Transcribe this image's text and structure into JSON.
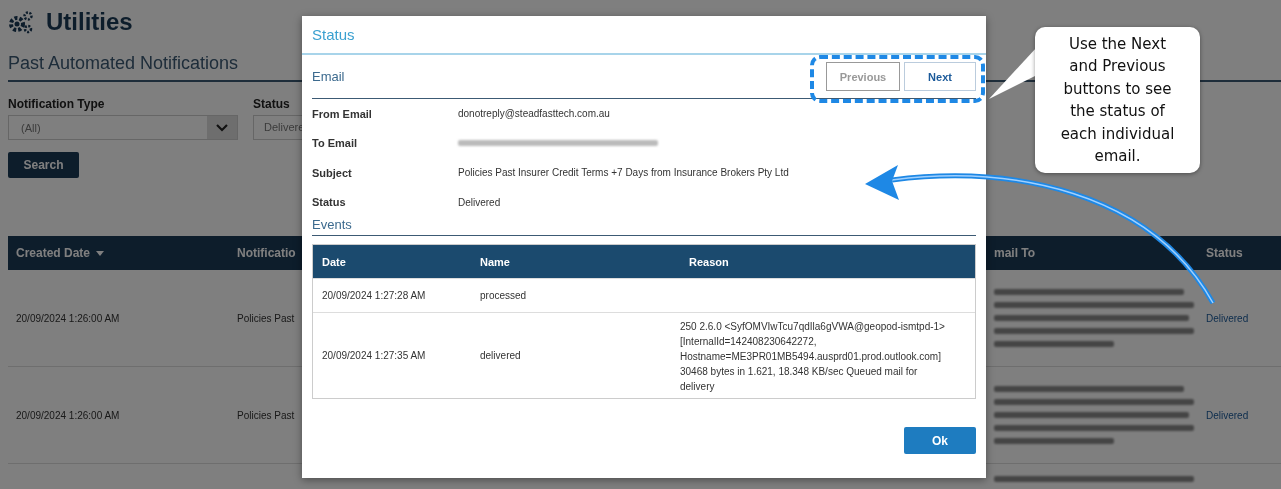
{
  "page": {
    "title": "Utilities",
    "subtitle": "Past Automated Notifications",
    "filters": [
      {
        "label": "Notification Type",
        "value": "(All)",
        "kind": "dropdown"
      },
      {
        "label": "Status",
        "value": "Delivere",
        "kind": "field"
      }
    ],
    "search_button": "Search",
    "table": {
      "columns": [
        {
          "label": "Created Date",
          "sorted": true
        },
        {
          "label": "Notificatio",
          "sorted": false
        },
        {
          "label": "mail To",
          "sorted": false
        },
        {
          "label": "Status",
          "sorted": false
        }
      ],
      "rows": [
        {
          "created_date": "20/09/2024 1:26:00 AM",
          "notification": "Policies Past",
          "status": "Delivered"
        },
        {
          "created_date": "20/09/2024 1:26:00 AM",
          "notification": "Policies Past",
          "status": "Delivered"
        }
      ]
    }
  },
  "dialog": {
    "title": "Status",
    "section": "Email",
    "buttons": [
      {
        "label": "Previous",
        "disabled": true
      },
      {
        "label": "Next",
        "disabled": false
      }
    ],
    "fields": [
      {
        "label": "From Email",
        "value": "donotreply@steadfasttech.com.au",
        "kind": "text"
      },
      {
        "label": "To Email",
        "kind": "blurred"
      },
      {
        "label": "Subject",
        "value": "Policies Past Insurer Credit Terms +7 Days from Insurance Brokers Pty Ltd",
        "kind": "text"
      },
      {
        "label": "Status",
        "value": "Delivered",
        "kind": "text"
      }
    ],
    "events_title": "Events",
    "events": {
      "columns": [
        "Date",
        "Name",
        "Reason"
      ],
      "rows": [
        {
          "date": "20/09/2024 1:27:28 AM",
          "name": "processed"
        },
        {
          "date": "20/09/2024 1:27:35 AM",
          "name": "delivered",
          "reason": [
            "250 2.6.0 <SyfOMVIwTcu7qdIla6gVWA@geopod-ismtpd-1>",
            "[InternalId=142408230642272,",
            "Hostname=ME3PR01MB5494.ausprd01.prod.outlook.com]",
            "30468 bytes in 1.621, 18.348 KB/sec Queued mail for",
            "delivery"
          ]
        }
      ]
    },
    "ok_button": "Ok"
  },
  "callout": {
    "lines": [
      "Use the Next",
      "and Previous",
      "buttons to see",
      "the status of",
      "each individual",
      "email."
    ]
  }
}
